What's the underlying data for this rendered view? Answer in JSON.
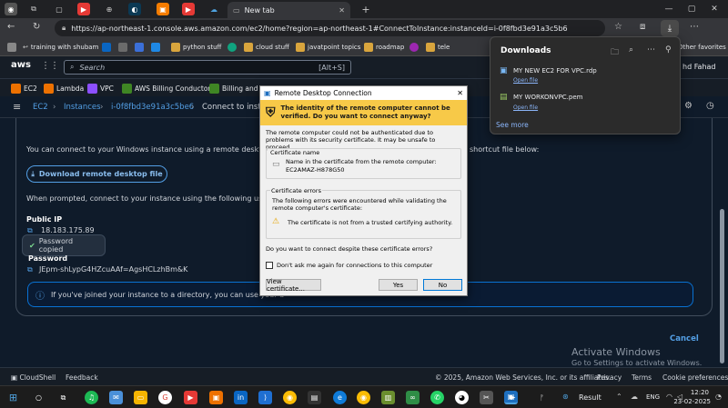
{
  "browser": {
    "active_tab_title": "New tab",
    "url": "https://ap-northeast-1.console.aws.amazon.com/ec2/home?region=ap-northeast-1#ConnectToInstance:instanceId=i-0f8fbd3e91a3c5b6",
    "bookmarks": [
      "training with shubam",
      "python stuff",
      "cloud stuff",
      "javatpoint topics",
      "roadmap",
      "tele"
    ],
    "other_favorites": "Other favorites"
  },
  "downloads": {
    "title": "Downloads",
    "items": [
      {
        "name": "MY NEW EC2 FOR VPC.rdp",
        "action": "Open file"
      },
      {
        "name": "MY WORKONVPC.pem",
        "action": "Open file"
      }
    ],
    "see_more": "See more"
  },
  "aws": {
    "search_placeholder": "Search",
    "search_shortcut": "[Alt+S]",
    "user_fragment": "hd Fahad",
    "favorites": [
      "EC2",
      "Lambda",
      "VPC",
      "AWS Billing Conductor",
      "Billing and Co"
    ],
    "breadcrumb": [
      "EC2",
      "Instances",
      "i-0f8fbd3e91a3c5be6",
      "Connect to insta"
    ]
  },
  "content": {
    "rdp_intro": "You can connect to your Windows instance using a remote desktop cl",
    "rdp_intro_end": "shortcut file below:",
    "download_button": "Download remote desktop file",
    "prompt_text": "When prompted, connect to your instance using the following userna",
    "public_ip_label": "Public IP",
    "public_ip": "18.183.175.89",
    "toast": "Password copied",
    "password_label": "Password",
    "password_value": "JEpm-shLypG4HZcuAAf=AgsHCLzhBm&K",
    "info_text": "If you've joined your instance to a directory, you can use your d",
    "cancel": "Cancel"
  },
  "watermark": {
    "line1": "Activate Windows",
    "line2": "Go to Settings to activate Windows."
  },
  "footer": {
    "cloudshell": "CloudShell",
    "feedback": "Feedback",
    "copyright": "© 2025, Amazon Web Services, Inc. or its affiliates.",
    "privacy": "Privacy",
    "terms": "Terms",
    "cookies": "Cookie preferences"
  },
  "dialog": {
    "title": "Remote Desktop Connection",
    "warning": "The identity of the remote computer cannot be verified. Do you want to connect anyway?",
    "message": "The remote computer could not be authenticated due to problems with its security certificate. It may be unsafe to proceed.",
    "cert_name_label": "Certificate name",
    "cert_name_desc": "Name in the certificate from the remote computer:",
    "cert_name_value": "EC2AMAZ-H878G50",
    "cert_errors_label": "Certificate errors",
    "cert_errors_desc": "The following errors were encountered while validating the remote computer's certificate:",
    "cert_error_item": "The certificate is not from a trusted certifying authority.",
    "question": "Do you want to connect despite these certificate errors?",
    "checkbox": "Don't ask me again for connections to this computer",
    "view_cert": "View certificate...",
    "yes": "Yes",
    "no": "No"
  },
  "taskbar": {
    "weather": "Result",
    "lang": "ENG",
    "time": "12:20",
    "date": "23-02-2025"
  }
}
